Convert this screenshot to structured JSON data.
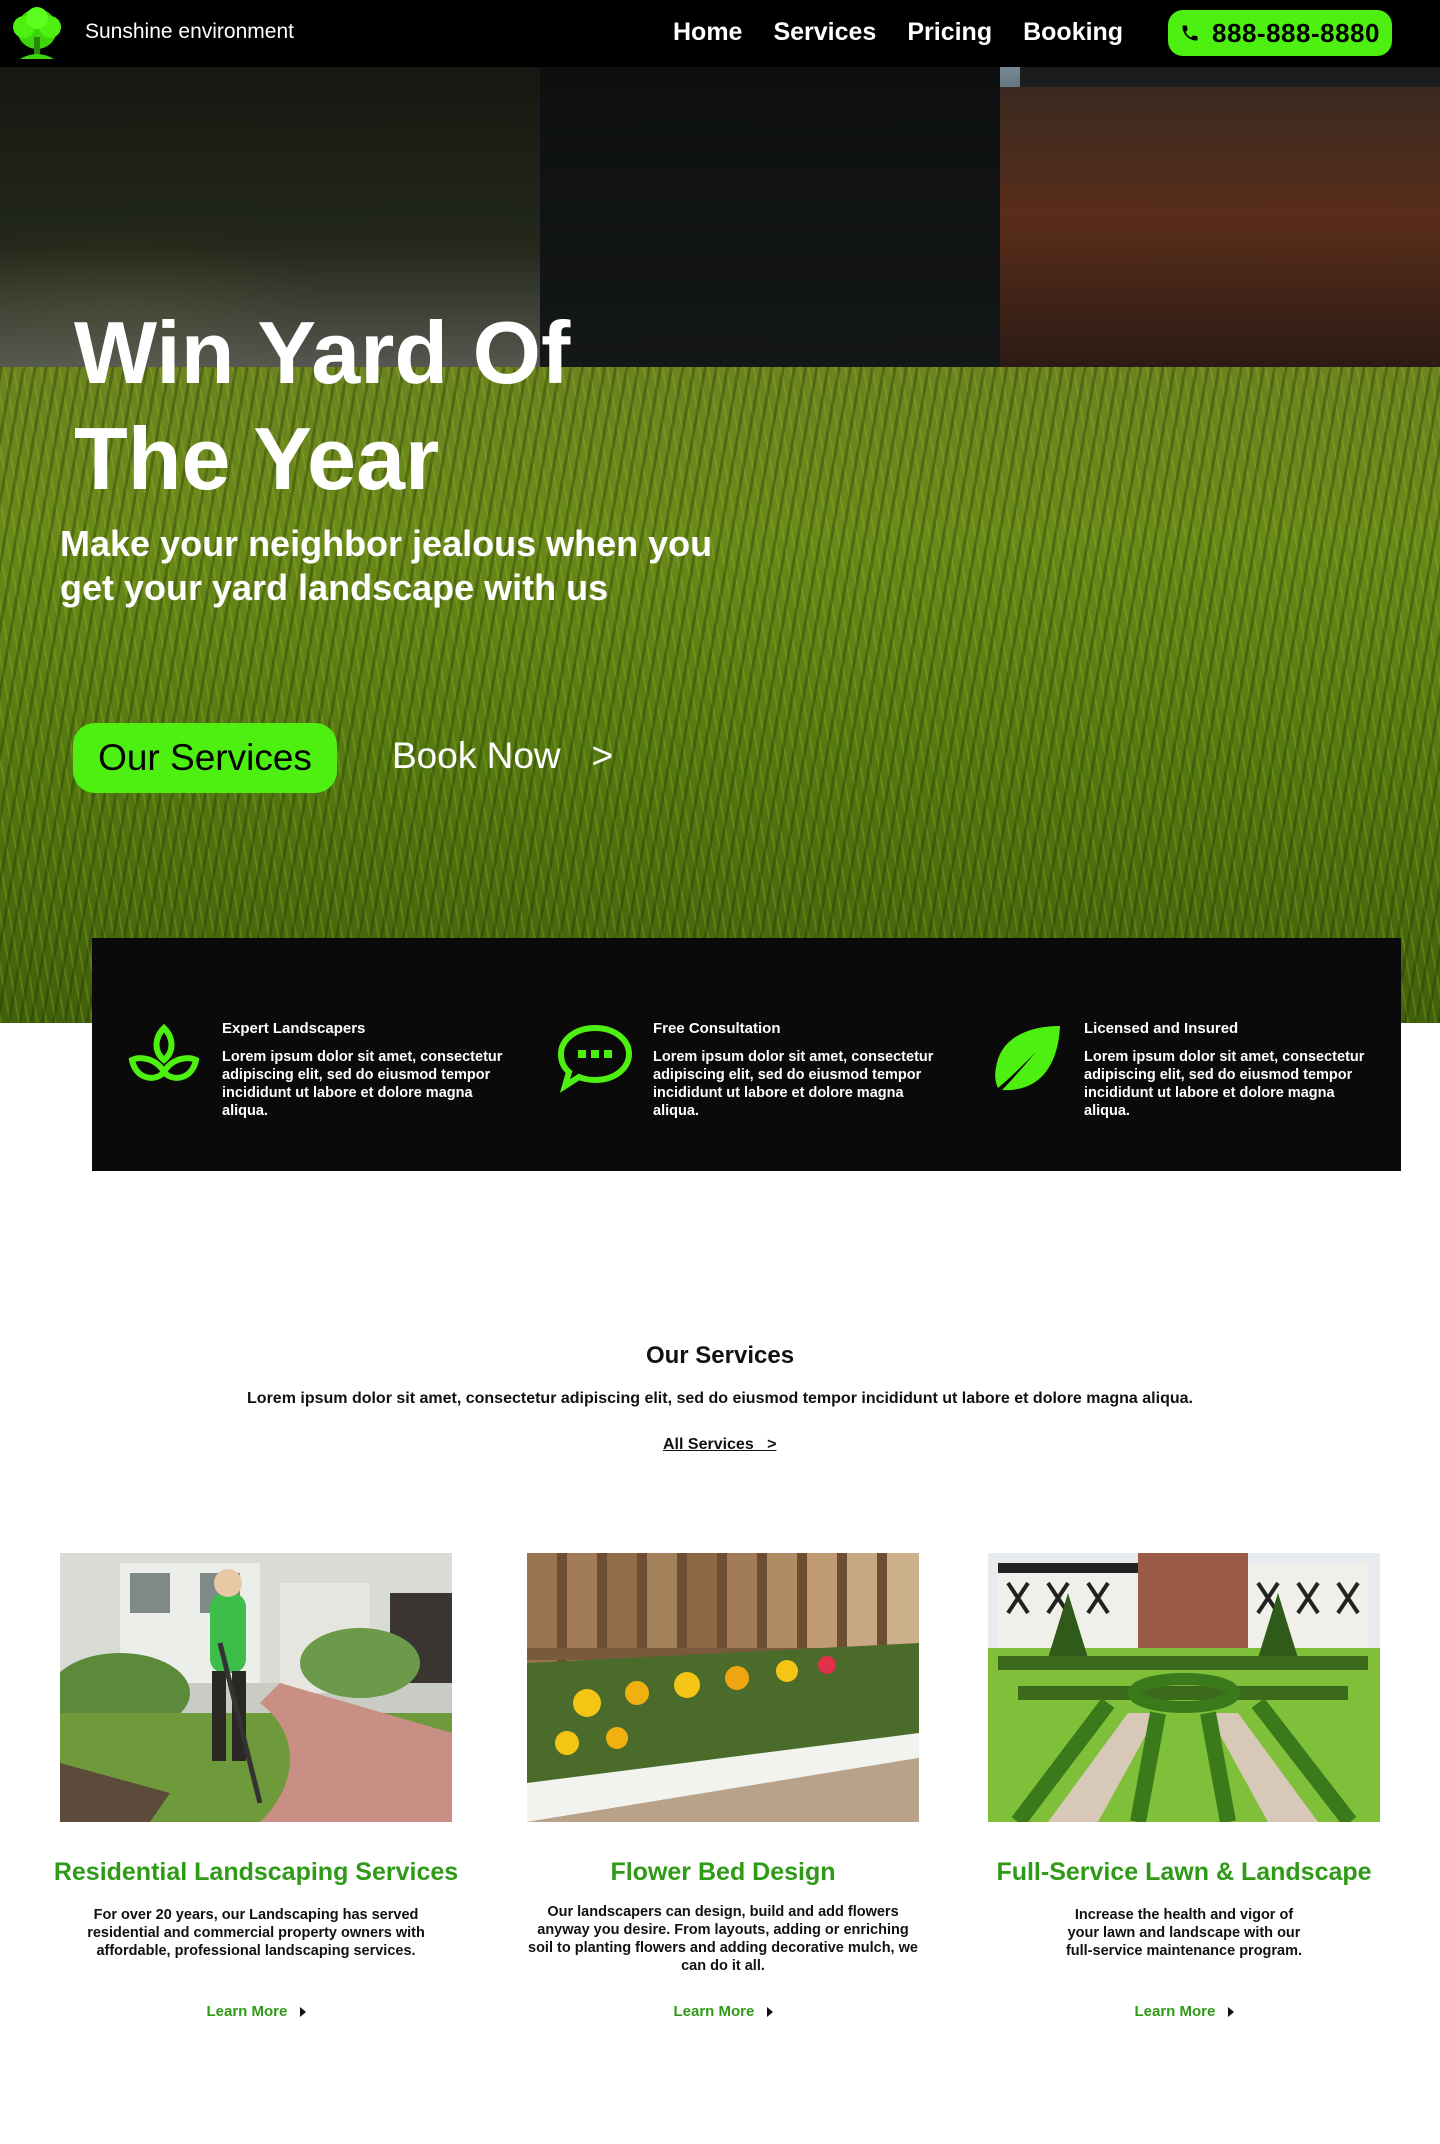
{
  "header": {
    "brand": "Sunshine environment",
    "nav": [
      "Home",
      "Services",
      "Pricing",
      "Booking"
    ],
    "phone": "888-888-8880"
  },
  "hero": {
    "title_line1": "Win Yard Of",
    "title_line2": "The Year",
    "subtitle_line1": "Make your neighbor jealous when you",
    "subtitle_line2": "get your yard landscape with us",
    "services_button": "Our Services",
    "book_button": "Book Now   >"
  },
  "features": [
    {
      "title": "Expert Landscapers",
      "desc": "Lorem ipsum dolor sit amet, consectetur adipiscing elit, sed do eiusmod tempor incididunt ut labore et dolore magna aliqua.",
      "icon": "sprout-icon"
    },
    {
      "title": "Free Consultation",
      "desc": "Lorem ipsum dolor sit amet, consectetur adipiscing elit, sed do eiusmod tempor incididunt ut labore et dolore magna aliqua.",
      "icon": "chat-bubble-icon"
    },
    {
      "title": "Licensed and Insured",
      "desc": "Lorem ipsum dolor sit amet, consectetur adipiscing elit, sed do eiusmod tempor incididunt ut labore et dolore magna aliqua.",
      "icon": "leaf-icon"
    }
  ],
  "services": {
    "heading": "Our Services",
    "intro": "Lorem ipsum dolor sit amet, consectetur adipiscing elit, sed do eiusmod tempor incididunt ut labore et dolore magna aliqua.",
    "all_link": "All Services   >",
    "cards": [
      {
        "title": "Residential Landscaping Services",
        "desc": "For over 20 years, our Landscaping has served residential and commercial property owners with affordable, professional landscaping services.",
        "link": "Learn More"
      },
      {
        "title": "Flower Bed Design",
        "desc": "Our landscapers can design, build and add flowers anyway you desire. From layouts, adding or enriching soil to planting flowers and adding decorative mulch, we can do it all.",
        "link": "Learn More"
      },
      {
        "title": "Full-Service Lawn & Landscape",
        "desc": "Increase the health and vigor of your lawn and landscape with our full-service maintenance program.",
        "link": "Learn More"
      }
    ]
  },
  "colors": {
    "accent": "#4df010",
    "link_green": "#2e9a16",
    "dark": "#0a0a0a"
  }
}
